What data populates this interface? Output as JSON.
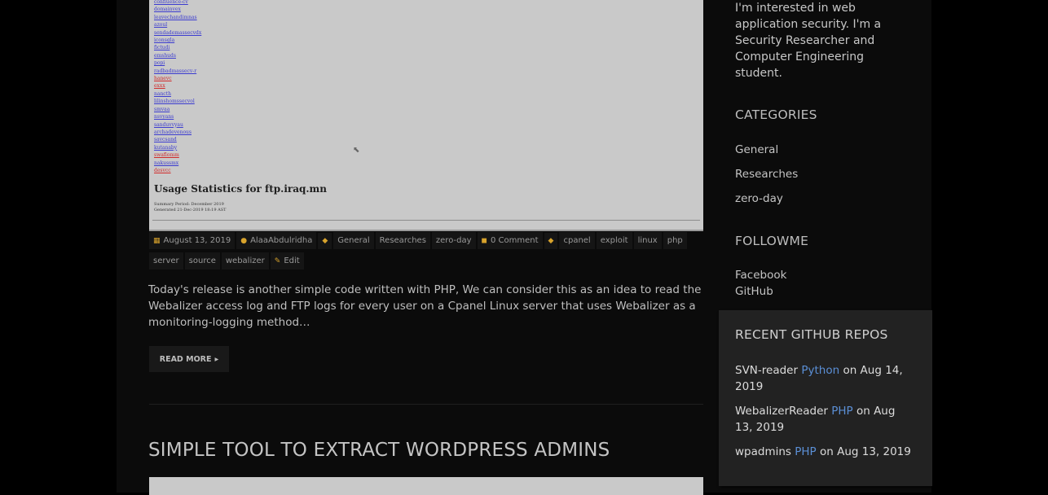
{
  "post_image": {
    "links": [
      {
        "text": "confluence-cv",
        "red": false
      },
      {
        "text": "domainvex",
        "red": false
      },
      {
        "text": "leavechandimnas",
        "red": false
      },
      {
        "text": "azoul",
        "red": false
      },
      {
        "text": "sendademassecvdx",
        "red": false
      },
      {
        "text": "iconsgla",
        "red": false
      },
      {
        "text": "fictudi",
        "red": false
      },
      {
        "text": "emshuds",
        "red": false
      },
      {
        "text": "popi",
        "red": false
      },
      {
        "text": "radbadmassecv-r",
        "red": false
      },
      {
        "text": "hanevc",
        "red": true
      },
      {
        "text": "exxx",
        "red": true
      },
      {
        "text": "nancth",
        "red": false
      },
      {
        "text": "lilinshomssecvol",
        "red": false
      },
      {
        "text": "smvaa",
        "red": false
      },
      {
        "text": "nsvyans",
        "red": false
      },
      {
        "text": "sanduvvyau",
        "red": false
      },
      {
        "text": "archadevenous",
        "red": false
      },
      {
        "text": "savcsand",
        "red": false
      },
      {
        "text": "kutanaby",
        "red": false
      },
      {
        "text": "swaflomm",
        "red": true
      },
      {
        "text": "nakussmx",
        "red": false
      },
      {
        "text": "desvcc",
        "red": true
      }
    ],
    "title": "Usage Statistics for ftp.iraq.mn",
    "summary_line1": "Summary Period: December 2019",
    "summary_line2": "Generated 21-Dec-2019 18:19 AST"
  },
  "meta": {
    "date": "August 13, 2019",
    "author": "AlaaAbdulridha",
    "categories": [
      "General",
      "Researches",
      "zero-day"
    ],
    "comments": "0 Comment",
    "tags": [
      "cpanel",
      "exploit",
      "linux",
      "php",
      "server",
      "source",
      "webalizer"
    ],
    "edit_label": "Edit"
  },
  "excerpt": "Today's release is another simple code written with PHP, We can consider this as an idea to read the Webalizer access log and FTP logs for every user on a Cpanel Linux server that uses Webalizer as a monitoring-logging method…",
  "read_more_label": "READ MORE",
  "next_post_title": "SIMPLE TOOL TO EXTRACT WORDPRESS ADMINS",
  "sidebar": {
    "about": "I'm interested in web application security. I'm a Security Researcher and Computer Engineering student.",
    "categories_heading": "CATEGORIES",
    "categories": [
      "General",
      "Researches",
      "zero-day"
    ],
    "follow_heading": "FOLLOWME",
    "follow_links": [
      "Facebook",
      "GitHub"
    ],
    "repos_heading": "RECENT GITHUB REPOS",
    "repos": [
      {
        "name": "SVN-reader",
        "lang": "Python",
        "date": "on Aug 14, 2019"
      },
      {
        "name": "WebalizerReader",
        "lang": "PHP",
        "date": "on Aug 13, 2019"
      },
      {
        "name": "wpadmins",
        "lang": "PHP",
        "date": "on Aug 13, 2019"
      }
    ]
  },
  "colors": {
    "language_link": "#5b8fd6",
    "meta_icon": "#d8a32c"
  }
}
